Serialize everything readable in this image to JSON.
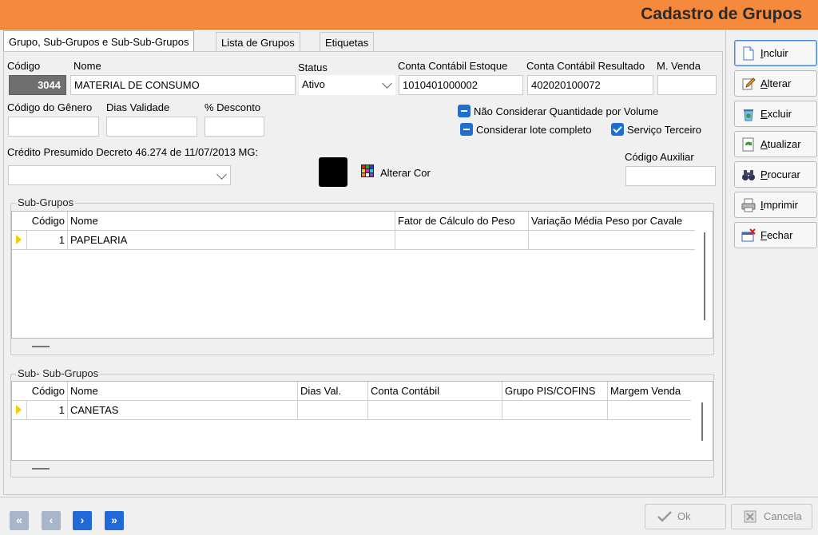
{
  "window": {
    "title": "Cadastro de Grupos"
  },
  "tabs": [
    {
      "label": "Grupo, Sub-Grupos e Sub-Sub-Grupos"
    },
    {
      "label": "Lista de Grupos"
    },
    {
      "label": "Etiquetas"
    }
  ],
  "form": {
    "codigo_label": "Código",
    "codigo_value": "3044",
    "nome_label": "Nome",
    "nome_value": "MATERIAL DE CONSUMO",
    "status_label": "Status",
    "status_value": "Ativo",
    "conta_estoque_label": "Conta Contábil Estoque",
    "conta_estoque_value": "1010401000002",
    "conta_resultado_label": "Conta Contábil Resultado",
    "conta_resultado_value": "402020100072",
    "m_venda_label": "M. Venda",
    "m_venda_value": "",
    "codigo_genero_label": "Código do Gênero",
    "dias_validade_label": "Dias Validade",
    "desconto_label": "% Desconto",
    "credito_label": "Crédito Presumido Decreto 46.274 de 11/07/2013 MG:",
    "credito_value": "",
    "codigo_auxiliar_label": "Código Auxiliar",
    "nao_considerar_label": "Não Considerar Quantidade por Volume",
    "considerar_lote_label": "Considerar lote completo",
    "servico_terceiro_label": "Serviço Terceiro",
    "alterar_cor_label": "Alterar Cor",
    "color_value": "#000000"
  },
  "subgrupos": {
    "title": "Sub-Grupos",
    "columns": [
      "Código",
      "Nome",
      "Fator de Cálculo do Peso",
      "Variação Média Peso por Cavale"
    ],
    "rows": [
      {
        "codigo": "1",
        "nome": "PAPELARIA",
        "fator": "",
        "variacao": ""
      }
    ]
  },
  "subsubgrupos": {
    "title": "Sub- Sub-Grupos",
    "columns": [
      "Código",
      "Nome",
      "Dias Val.",
      "Conta Contábil",
      "Grupo PIS/COFINS",
      "Margem Venda"
    ],
    "rows": [
      {
        "codigo": "1",
        "nome": "CANETAS",
        "dias": "",
        "conta": "",
        "pis": "",
        "margem": ""
      }
    ]
  },
  "sidebar": {
    "buttons": [
      {
        "key": "I",
        "rest": "ncluir"
      },
      {
        "key": "A",
        "rest": "lterar"
      },
      {
        "key": "E",
        "rest": "xcluir"
      },
      {
        "key": "A",
        "rest": "tualizar"
      },
      {
        "key": "P",
        "rest": "rocurar"
      },
      {
        "key": "I",
        "rest": "mprimir"
      },
      {
        "key": "F",
        "rest": "echar"
      }
    ]
  },
  "footer": {
    "ok_key": "O",
    "ok_rest": "k",
    "cancel_key": "C",
    "cancel_rest": "ancela",
    "nav": [
      "«",
      "‹",
      "›",
      "»"
    ]
  }
}
